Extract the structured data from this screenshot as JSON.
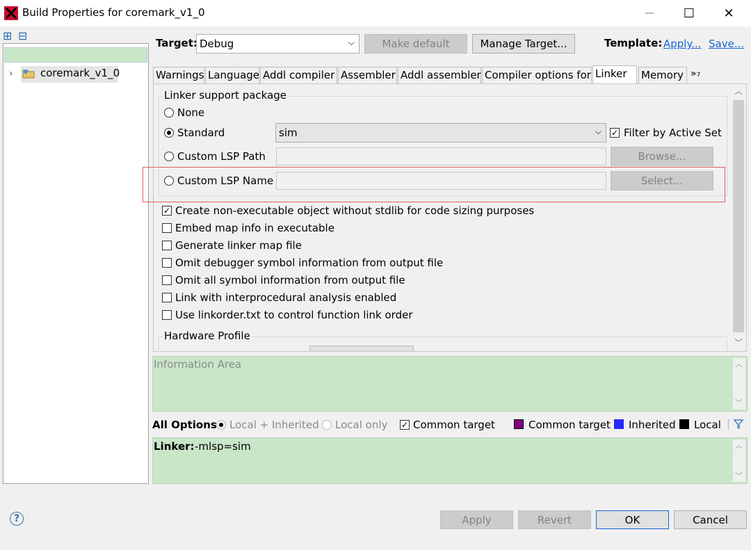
{
  "window": {
    "title": "Build Properties for coremark_v1_0",
    "minimize": "—",
    "maximize": "☐",
    "close": "✕"
  },
  "tree": {
    "expand_all": "⊞",
    "collapse_all": "⊟",
    "items": [
      {
        "label": "coremark_v1_0"
      }
    ]
  },
  "header": {
    "target_label": "Target:",
    "target_value": "Debug",
    "make_default": "Make default",
    "manage_target": "Manage Target...",
    "template_label": "Template:",
    "apply_link": "Apply...",
    "save_link": "Save..."
  },
  "tabs": [
    "Warnings",
    "Language",
    "Addl compiler",
    "Assembler",
    "Addl assembler",
    "Compiler options for",
    "Linker",
    "Memory",
    "»₇"
  ],
  "active_tab": "Linker",
  "linker": {
    "lsp_group": "Linker support package",
    "none": "None",
    "standard": "Standard",
    "standard_value": "sim",
    "filter_label": "Filter by Active Set",
    "custom_path": "Custom LSP Path",
    "browse": "Browse...",
    "custom_name": "Custom LSP Name",
    "select": "Select...",
    "options": [
      {
        "label": "Create non-executable object without stdlib for code sizing purposes",
        "checked": true
      },
      {
        "label": "Embed map info in executable",
        "checked": false
      },
      {
        "label": "Generate linker map file",
        "checked": false
      },
      {
        "label": "Omit debugger symbol information from output file",
        "checked": false
      },
      {
        "label": "Omit all symbol information from output file",
        "checked": false
      },
      {
        "label": "Link with interprocedural analysis enabled",
        "checked": false
      },
      {
        "label": "Use linkorder.txt to control function link order",
        "checked": false
      }
    ],
    "hardware_profile": "Hardware Profile"
  },
  "info_area": {
    "placeholder": "Information Area"
  },
  "options_bar": {
    "all_options": "All Options:",
    "local_inherited": "Local + Inherited",
    "local_only": "Local only",
    "common_target_check": "Common target",
    "legend": [
      {
        "label": "Common target",
        "color": "#800080"
      },
      {
        "label": "Inherited",
        "color": "#2a2aff"
      },
      {
        "label": "Local",
        "color": "#000000"
      }
    ]
  },
  "command_line": {
    "label": "Linker:",
    "value": "-mlsp=sim"
  },
  "footer": {
    "help": "?",
    "apply": "Apply",
    "revert": "Revert",
    "ok": "OK",
    "cancel": "Cancel"
  },
  "colors": {
    "green_area": "#c9e6c9",
    "link": "#1a63d6",
    "highlight_box": "#e06060"
  }
}
